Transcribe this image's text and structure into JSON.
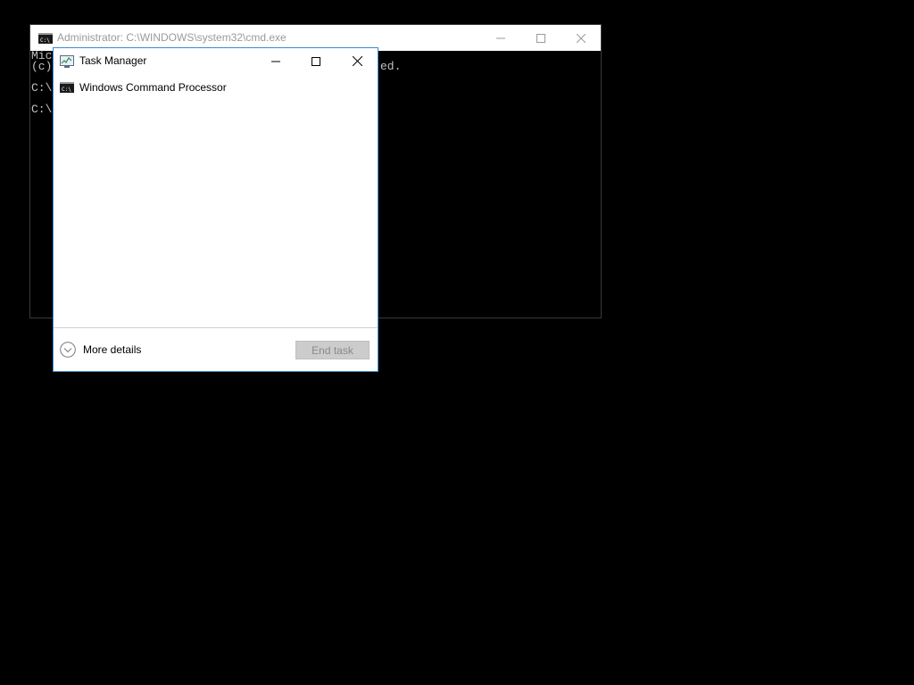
{
  "cmd_window": {
    "title": "Administrator: C:\\WINDOWS\\system32\\cmd.exe",
    "lines": [
      "Mic",
      "(c)",
      "C:\\",
      "C:\\"
    ],
    "trailing_fragment": "ed.",
    "icon": "cmd-icon",
    "controls": {
      "minimize": "minimize-icon",
      "maximize": "maximize-icon",
      "close": "close-icon"
    }
  },
  "task_manager": {
    "title": "Task Manager",
    "icon": "task-manager-icon",
    "apps": [
      {
        "label": "Windows Command Processor",
        "icon": "cmd-icon"
      }
    ],
    "more_details_label": "More details",
    "end_task_label": "End task",
    "end_task_enabled": false,
    "accent_color": "#3a8ad6"
  }
}
